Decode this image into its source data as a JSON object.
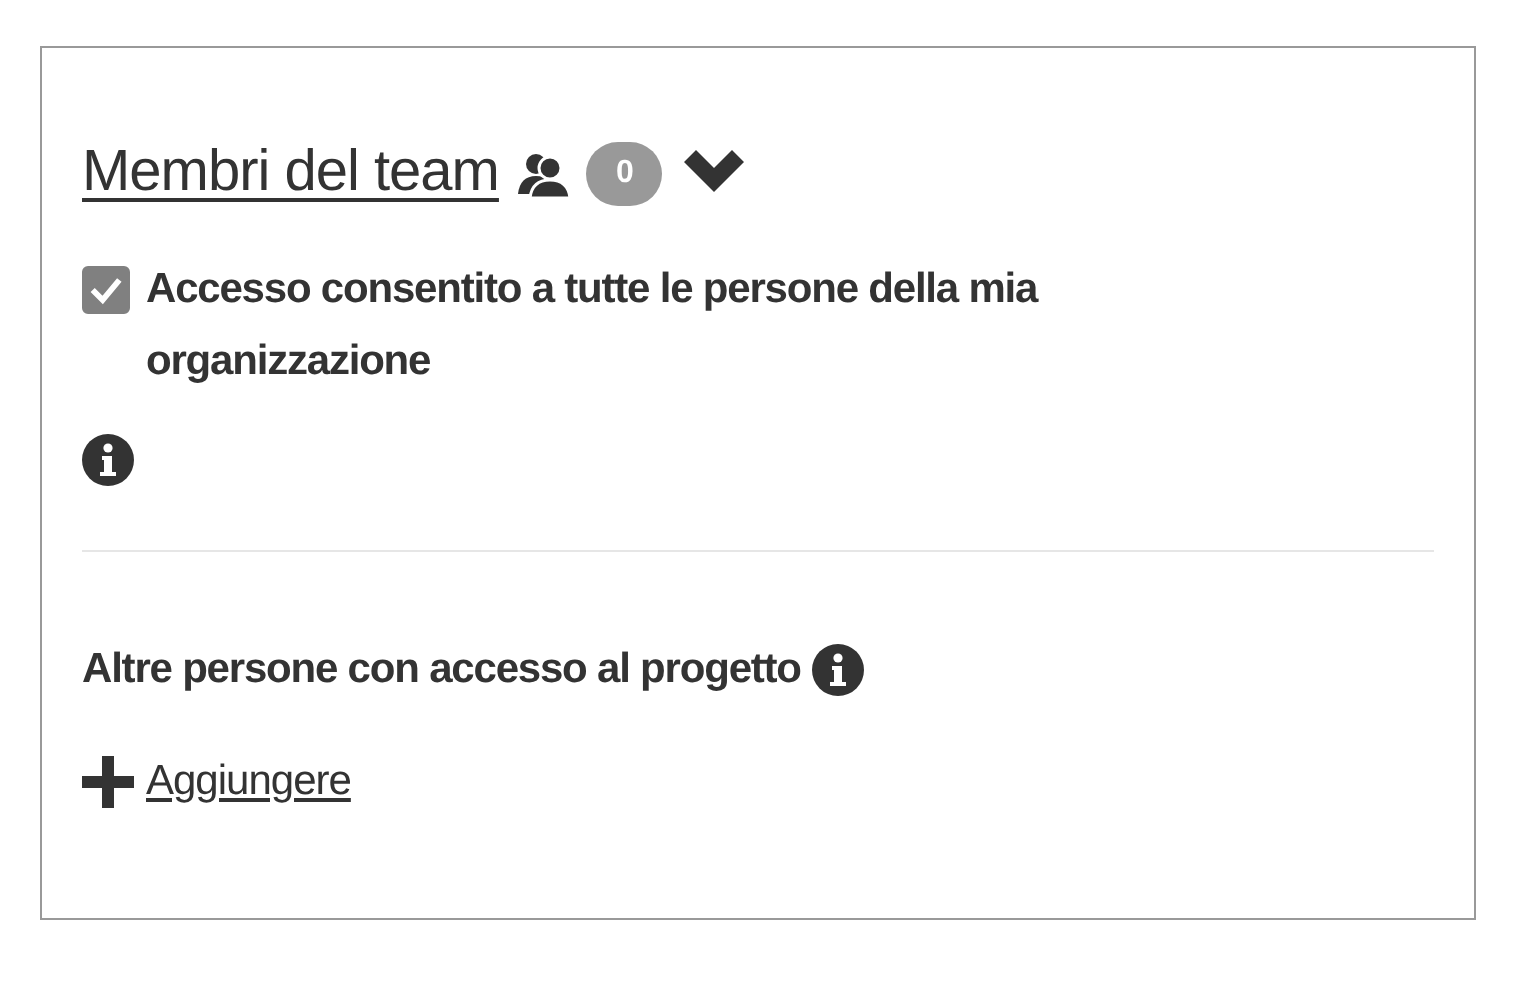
{
  "team_section": {
    "title": "Membri del team",
    "member_count": "0"
  },
  "organization_access": {
    "label": "Accesso consentito a tutte le persone della mia organizzazione",
    "checked": true
  },
  "other_people": {
    "heading": "Altre persone con accesso al progetto",
    "add_link": "Aggiungere"
  }
}
